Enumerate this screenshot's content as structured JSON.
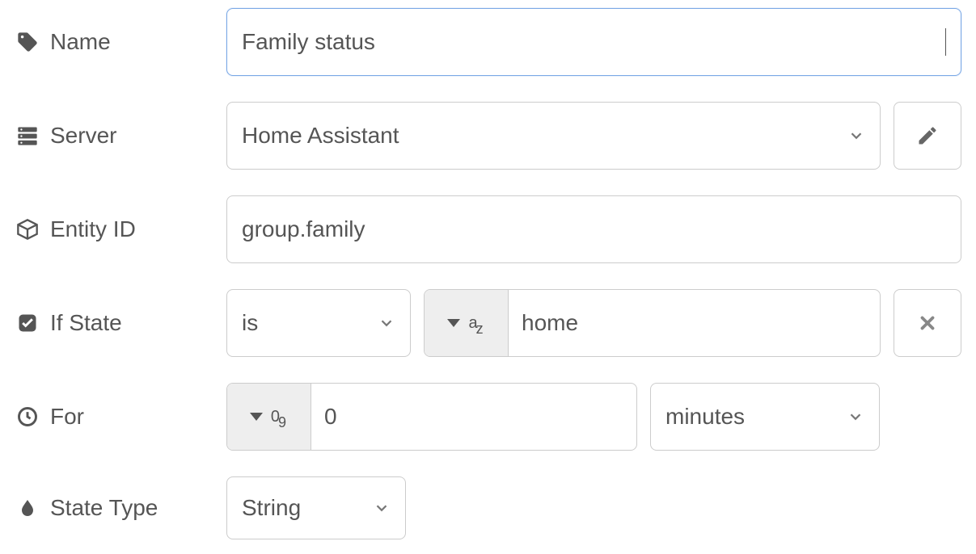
{
  "labels": {
    "name": "Name",
    "server": "Server",
    "entity_id": "Entity ID",
    "if_state": "If State",
    "for": "For",
    "state_type": "State Type"
  },
  "name": {
    "value": "Family status"
  },
  "server": {
    "selected": "Home Assistant"
  },
  "entity_id": {
    "value": "group.family"
  },
  "if_state": {
    "comparator": "is",
    "value": "home"
  },
  "for": {
    "value": "0",
    "unit": "minutes"
  },
  "state_type": {
    "selected": "String"
  },
  "icons": {
    "name": "tag-icon",
    "server": "server-icon",
    "entity_id": "cube-icon",
    "if_state": "check-square-icon",
    "for": "clock-icon",
    "state_type": "tint-icon",
    "edit": "pencil-icon",
    "remove": "x-icon",
    "chevron": "chevron-down-icon"
  }
}
